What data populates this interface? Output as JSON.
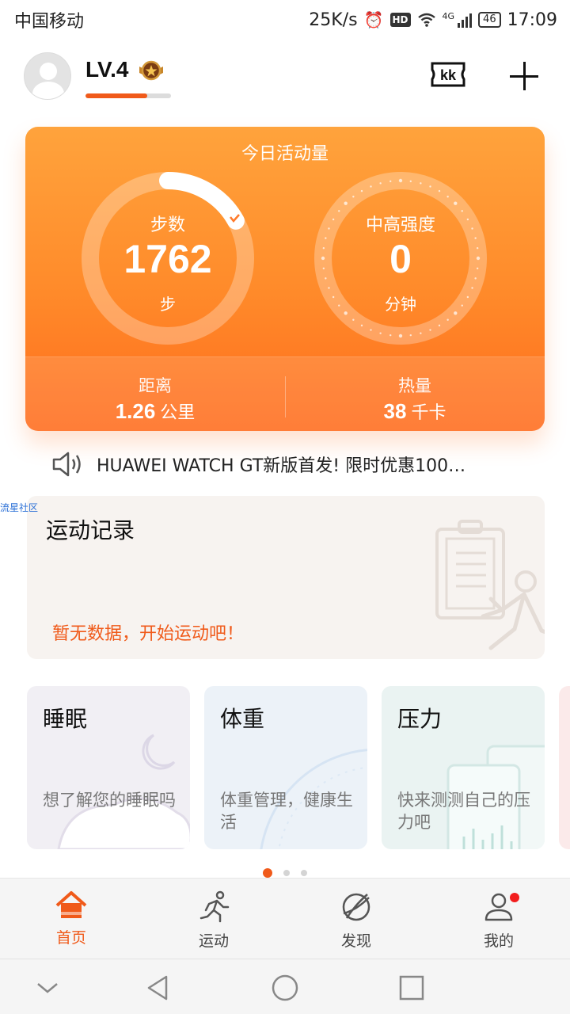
{
  "status_bar": {
    "carrier": "中国移动",
    "net_speed": "25K/s",
    "hd": "HD",
    "network": "4G",
    "battery": "46",
    "time": "17:09"
  },
  "header": {
    "level": "LV.4",
    "level_progress": 0.72,
    "kk_label": "kk"
  },
  "activity": {
    "title": "今日活动量",
    "steps_label": "步数",
    "steps_value": "1762",
    "steps_unit": "步",
    "steps_progress": 0.17,
    "intensity_label": "中高强度",
    "intensity_value": "0",
    "intensity_unit": "分钟",
    "distance_label": "距离",
    "distance_value": "1.26",
    "distance_unit": "公里",
    "calories_label": "热量",
    "calories_value": "38",
    "calories_unit": "千卡"
  },
  "announcement": {
    "text": "HUAWEI WATCH GT新版首发! 限时优惠100…"
  },
  "floating_label": "流星社区",
  "record": {
    "title": "运动记录",
    "hint": "暂无数据，开始运动吧！"
  },
  "features": [
    {
      "title": "睡眠",
      "desc": "想了解您的睡眠吗"
    },
    {
      "title": "体重",
      "desc": "体重管理，健康生活"
    },
    {
      "title": "压力",
      "desc": "快来测测自己的压力吧"
    }
  ],
  "tabs": [
    {
      "label": "首页",
      "icon": "home-icon"
    },
    {
      "label": "运动",
      "icon": "running-icon"
    },
    {
      "label": "发现",
      "icon": "discover-icon"
    },
    {
      "label": "我的",
      "icon": "profile-icon"
    }
  ],
  "colors": {
    "accent": "#f05a1a",
    "card_top": "#ffa33c",
    "card_bottom": "#ff6c1d",
    "badge": "#f21d1d"
  }
}
